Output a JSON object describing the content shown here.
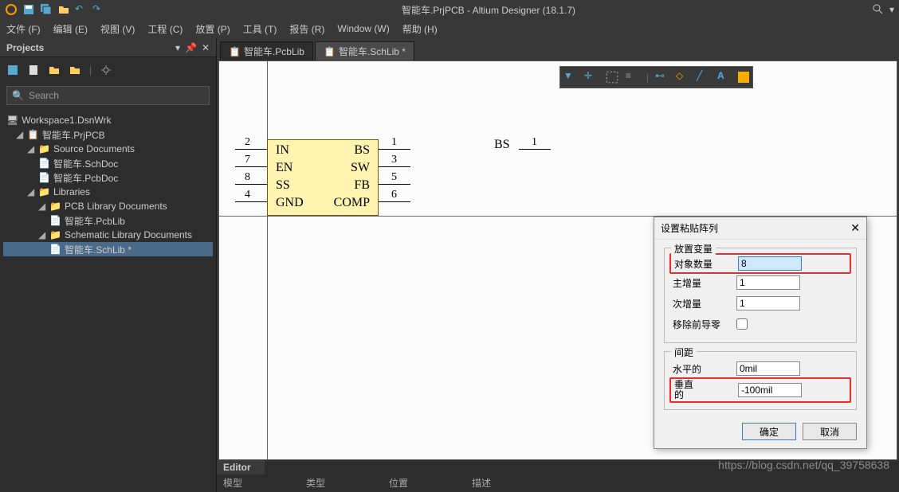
{
  "titlebar": {
    "title": "智能车.PrjPCB - Altium Designer (18.1.7)"
  },
  "menu": [
    "文件 (F)",
    "编辑 (E)",
    "视图 (V)",
    "工程 (C)",
    "放置 (P)",
    "工具 (T)",
    "报告 (R)",
    "Window (W)",
    "帮助 (H)"
  ],
  "panel": {
    "title": "Projects",
    "search_placeholder": "Search"
  },
  "tree": {
    "root": "Workspace1.DsnWrk",
    "project": "智能车.PrjPCB",
    "srcdocs": "Source Documents",
    "schdoc": "智能车.SchDoc",
    "pcbdoc": "智能车.PcbDoc",
    "libs": "Libraries",
    "pcblibdocs": "PCB Library Documents",
    "pcblib": "智能车.PcbLib",
    "schlibdocs": "Schematic Library Documents",
    "schlib": "智能车.SchLib *"
  },
  "tabs": {
    "t1": "智能车.PcbLib",
    "t2": "智能车.SchLib *"
  },
  "component": {
    "pins_left": [
      "IN",
      "EN",
      "SS",
      "GND"
    ],
    "pins_right": [
      "BS",
      "SW",
      "FB",
      "COMP"
    ],
    "nums_left": [
      "2",
      "7",
      "8",
      "4"
    ],
    "nums_right": [
      "1",
      "3",
      "5",
      "6"
    ],
    "float_pin": "BS",
    "float_num": "1"
  },
  "dialog": {
    "title": "设置粘贴阵列",
    "group1": "放置变量",
    "count_label": "对象数量",
    "count_value": "8",
    "main_inc_label": "主增量",
    "main_inc_value": "1",
    "sec_inc_label": "次增量",
    "sec_inc_value": "1",
    "remove_zero_label": "移除前导零",
    "group2": "间距",
    "horiz_label": "水平的",
    "horiz_value": "0mil",
    "vert_label": "垂直\n的",
    "vert_value": "-100mil",
    "ok": "确定",
    "cancel": "取消"
  },
  "bottom": {
    "tab": "Editor",
    "cols": [
      "模型",
      "类型",
      "位置",
      "描述"
    ]
  },
  "watermark": "https://blog.csdn.net/qq_39758638"
}
